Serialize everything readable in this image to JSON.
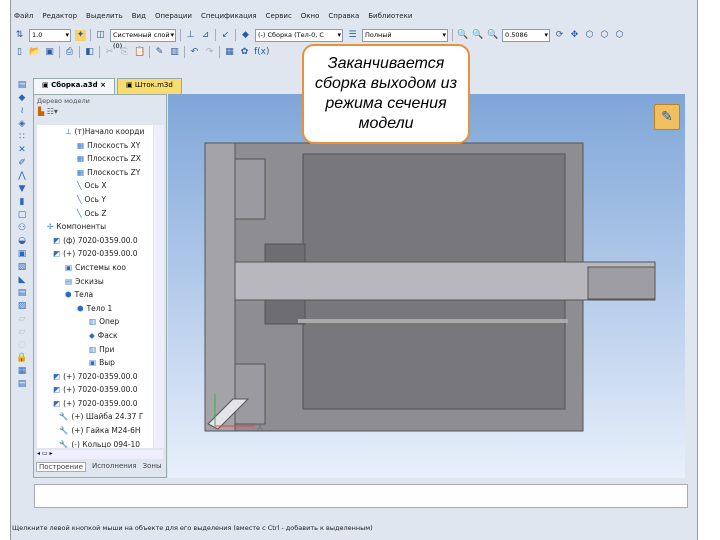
{
  "menu": [
    "Файл",
    "Редактор",
    "Выделить",
    "Вид",
    "Операции",
    "Спецификация",
    "Сервис",
    "Окно",
    "Справка",
    "Библиотеки"
  ],
  "toolbar": {
    "step": "1.0",
    "layer": "Системный слой (0)",
    "component": "(-) Сборка (Тел-0, С",
    "view_mode": "Полный",
    "zoom": "0.5086"
  },
  "tabs": [
    {
      "label": "Сборка.a3d"
    },
    {
      "label": "Шток.m3d"
    }
  ],
  "tree": {
    "title": "Дерево модели",
    "nodes": [
      "(т)Начало коорди",
      "Плоскость XY",
      "Плоскость ZX",
      "Плоскость ZY",
      "Ось X",
      "Ось Y",
      "Ось Z",
      "Компоненты",
      "(ф) 7020-0359.00.0",
      "(+) 7020-0359.00.0",
      "Системы коо",
      "Эскизы",
      "Тела",
      "Тело 1",
      "Опер",
      "Фаск",
      "При",
      "Выр",
      "(+) 7020-0359.00.0",
      "(+) 7020-0359.00.0",
      "(+) 7020-0359.00.0",
      "(+) Шайба 24.37 Г",
      "(+) Гайка М24-6Н",
      "(-) Кольцо 094-10"
    ],
    "bottom_tabs": [
      "Построение",
      "Исполнения",
      "Зоны"
    ]
  },
  "callout": "Заканчивается сборка выходом из режима сечения модели",
  "axis_label": "X",
  "status": "Щелкните левой кнопкой мыши на объекте для его выделения (вместе с Ctrl - добавить к выделенным)"
}
